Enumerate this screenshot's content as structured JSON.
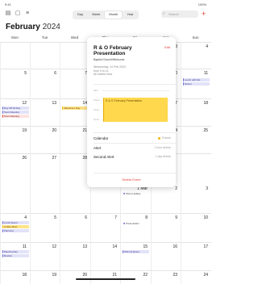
{
  "status": {
    "time": "9:41",
    "date": "Mon Feb 12",
    "battery": "100%"
  },
  "toolbar": {
    "views": [
      "Day",
      "Week",
      "Month",
      "Year"
    ],
    "active_view": "Month",
    "search_placeholder": "Search"
  },
  "header": {
    "month": "February",
    "year": "2024"
  },
  "weekdays": [
    "Mon",
    "Tue",
    "Wed",
    "Thu",
    "Fri",
    "Sat",
    "Sun"
  ],
  "weeks": [
    [
      "",
      "",
      "",
      "1",
      "2",
      "3",
      "4"
    ],
    [
      "5",
      "6",
      "7",
      "8",
      "9",
      "10",
      "11"
    ],
    [
      "12",
      "13",
      "14",
      "15",
      "16",
      "17",
      "18"
    ],
    [
      "19",
      "20",
      "21",
      "22",
      "23",
      "24",
      "25"
    ],
    [
      "26",
      "27",
      "28",
      "29",
      "1 Mar",
      "2",
      "3"
    ],
    [
      "4",
      "5",
      "6",
      "7",
      "8",
      "9",
      "10"
    ],
    [
      "11",
      "12",
      "13",
      "14",
      "15",
      "16",
      "17"
    ],
    [
      "18",
      "19",
      "20",
      "21",
      "22",
      "23",
      "24"
    ]
  ],
  "events": {
    "mon12": [
      "Day Off All Day",
      "Team Meeting"
    ],
    "wed14": "Valentine's Day",
    "sun11": [
      "Lunch with Mo",
      "Dinner"
    ],
    "fri1mar": "Show Holiday",
    "mon4": [
      "Lunch Event",
      "Coffee Meet",
      "Planning"
    ],
    "fri8": "Presentation",
    "mon11": [
      "Meeting Day",
      "Review"
    ],
    "fri15": "Pick Up Event"
  },
  "popover": {
    "title": "R & O February Presentation",
    "edit_label": "Edit",
    "location": "Baptist Church/Welcome",
    "date_line1": "Wednesday, 14 Feb 2024",
    "date_line2": "from 9 to 11",
    "date_line3": "All Invited Now",
    "timeline_hours": [
      "9am",
      "10am",
      "11am",
      "Noon"
    ],
    "block_text": "R & O February Presentation",
    "calendar_label": "Calendar",
    "calendar_value": "Events",
    "alert_label": "Alert",
    "alert_value": "1 hour before",
    "second_alert_label": "Second Alert",
    "second_alert_value": "1 day before",
    "delete_label": "Delete Event"
  },
  "colors": {
    "accent": "#e03c2e",
    "event_purple": "#6b6bd6",
    "event_yellow": "#ffd84d"
  }
}
